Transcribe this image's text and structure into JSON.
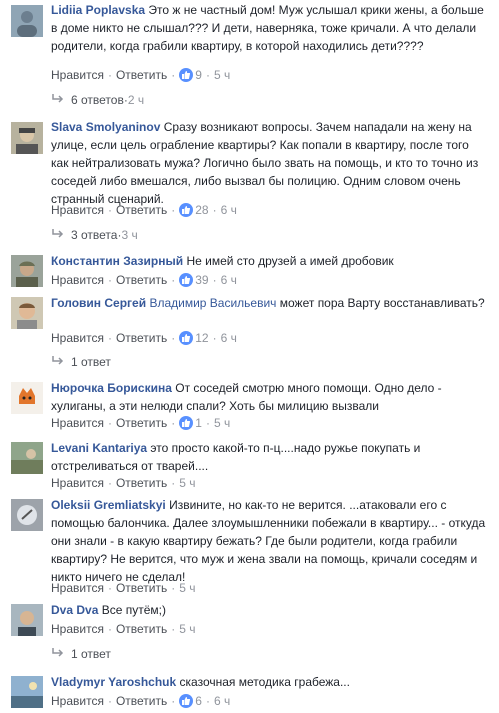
{
  "ui": {
    "like": "Нравится",
    "reply": "Ответить",
    "sep": "·"
  },
  "comments": [
    {
      "author": "Lidiia Poplavska",
      "text": "Это ж не частный дом! Муж услышал крики жены, а больше в доме никто не слышал??? И дети, наверняка, тоже кричали. А что делали родители, когда грабили квартиру, в которой находились дети????",
      "likes": "9",
      "time": "5 ч",
      "replies": {
        "label": "6 ответов",
        "time": "2 ч"
      }
    },
    {
      "author": "Slava Smolyaninov",
      "text": "Сразу возникают вопросы. Зачем нападали на жену на улице, если цель ограбление квартиры? Как попали в квартиру, после того как нейтрализовать мужа? Логично было звать на помощь, и кто то точно из соседей либо вмешался, либо вызвал бы полицию. Одним словом очень странный сценарий.",
      "likes": "28",
      "time": "6 ч",
      "replies": {
        "label": "3 ответа",
        "time": "3 ч"
      }
    },
    {
      "author": "Константин Зазирный",
      "text": "Не имей сто друзей а имей дробовик",
      "likes": "39",
      "time": "6 ч"
    },
    {
      "author": "Головин Сергей",
      "mention": "Владимир Васильевич",
      "text": "может пора Варту восстанавливать?",
      "likes": "12",
      "time": "6 ч",
      "replies": {
        "label": "1 ответ",
        "time": ""
      }
    },
    {
      "author": "Нюрочка Борискина",
      "text": "От соседей смотрю много помощи. Одно дело - хулиганы, а эти нелюди спали? Хоть бы милицию вызвали",
      "likes": "1",
      "time": "5 ч"
    },
    {
      "author": "Levani Kantariya",
      "text": "это просто какой-то п-ц....надо ружье покупать и отстреливаться от тварей....",
      "likes": "",
      "time": "5 ч"
    },
    {
      "author": "Oleksii Gremliatskyi",
      "text": "Извините, но как-то не верится. ...атаковали его с помощью балончика. Далее злоумышленники побежали в квартиру... - откуда они знали - в какую квартиру бежать? Где были родители, когда грабили квартиру? Не верится, что муж и жена звали на помощь, кричали соседям и никто ничего не сделал!",
      "likes": "",
      "time": "5 ч"
    },
    {
      "author": "Dva Dva",
      "text": "Все путём;)",
      "likes": "",
      "time": "5 ч",
      "replies": {
        "label": "1 ответ",
        "time": ""
      }
    },
    {
      "author": "Vladymyr Yaroshchuk",
      "text": "сказочная методика грабежа...",
      "likes": "6",
      "time": "6 ч"
    }
  ]
}
